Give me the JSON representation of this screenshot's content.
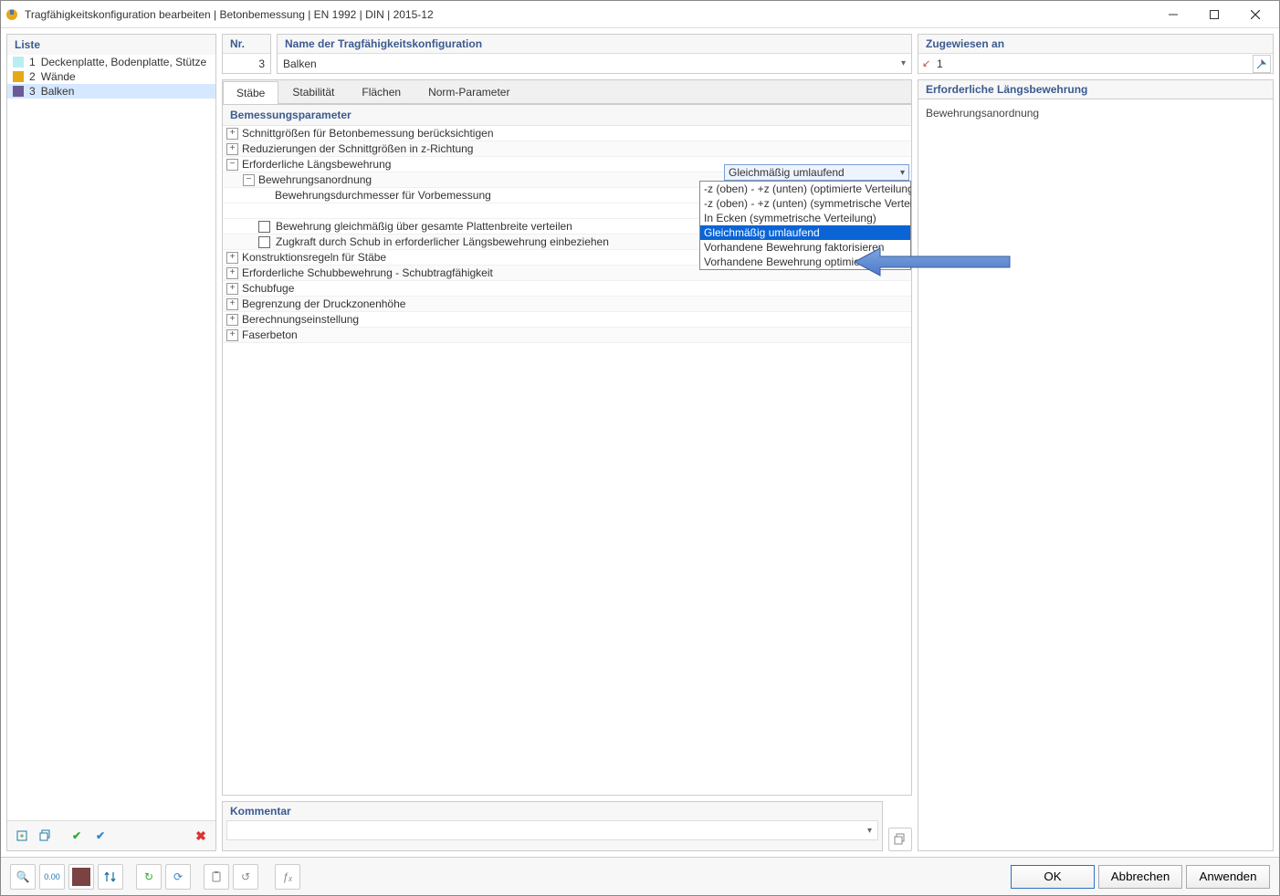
{
  "title": "Tragfähigkeitskonfiguration bearbeiten | Betonbemessung | EN 1992 | DIN | 2015-12",
  "leftPanel": {
    "header": "Liste",
    "items": [
      {
        "num": "1",
        "label": "Deckenplatte, Bodenplatte, Stütze",
        "color": "#b8eef0"
      },
      {
        "num": "2",
        "label": "Wände",
        "color": "#e6a817"
      },
      {
        "num": "3",
        "label": "Balken",
        "color": "#6b5b95"
      }
    ],
    "selectedIndex": 2
  },
  "nrBox": {
    "label": "Nr.",
    "value": "3"
  },
  "nameBox": {
    "label": "Name der Tragfähigkeitskonfiguration",
    "value": "Balken"
  },
  "assigned": {
    "label": "Zugewiesen an",
    "value": "1",
    "iconGlyph": "↙"
  },
  "tabs": {
    "items": [
      "Stäbe",
      "Stabilität",
      "Flächen",
      "Norm-Parameter"
    ],
    "active": 0
  },
  "paramHeader": "Bemessungsparameter",
  "tree": [
    {
      "level": 0,
      "exp": "+",
      "text": "Schnittgrößen für Betonbemessung berücksichtigen"
    },
    {
      "level": 0,
      "exp": "+",
      "text": "Reduzierungen der Schnittgrößen in z-Richtung"
    },
    {
      "level": 0,
      "exp": "-",
      "text": "Erforderliche Längsbewehrung"
    },
    {
      "level": 1,
      "exp": "-",
      "text": "Bewehrungsanordnung",
      "hasCombo": true
    },
    {
      "level": 2,
      "exp": "",
      "text": "Bewehrungsdurchmesser für Vorbemessung"
    },
    {
      "level": 1,
      "exp": "",
      "text": "Bewehrung gleichmäßig über gesamte Plattenbreite verteilen",
      "cb": true
    },
    {
      "level": 1,
      "exp": "",
      "text": "Zugkraft durch Schub in erforderlicher Längsbewehrung einbeziehen",
      "cb": true
    },
    {
      "level": 0,
      "exp": "+",
      "text": "Konstruktionsregeln für Stäbe"
    },
    {
      "level": 0,
      "exp": "+",
      "text": "Erforderliche Schubbewehrung - Schubtragfähigkeit"
    },
    {
      "level": 0,
      "exp": "+",
      "text": "Schubfuge"
    },
    {
      "level": 0,
      "exp": "+",
      "text": "Begrenzung der Druckzonenhöhe"
    },
    {
      "level": 0,
      "exp": "+",
      "text": "Berechnungseinstellung"
    },
    {
      "level": 0,
      "exp": "+",
      "text": "Faserbeton"
    }
  ],
  "comboSelected": "Gleichmäßig umlaufend",
  "dropdown": {
    "items": [
      "-z (oben) - +z (unten) (optimierte Verteilung)",
      "-z (oben) - +z (unten) (symmetrische Verteilung)",
      "In Ecken (symmetrische Verteilung)",
      "Gleichmäßig umlaufend",
      "Vorhandene Bewehrung faktorisieren",
      "Vorhandene Bewehrung optimieren"
    ],
    "highlightIndex": 3
  },
  "detail": {
    "header": "Erforderliche Längsbewehrung",
    "body": "Bewehrungsanordnung"
  },
  "commentLabel": "Kommentar",
  "bottomButtons": {
    "ok": "OK",
    "cancel": "Abbrechen",
    "apply": "Anwenden"
  },
  "icons": {
    "newWindow": "◻",
    "duplicate": "⧉",
    "checkGreen": "✔",
    "checkBlue": "✔",
    "delete": "✖",
    "magnify": "🔍",
    "units": "0.00",
    "colorbox": "#7a4242",
    "tree": "⇵",
    "refreshGreen": "↻",
    "refreshBlue": "⟳",
    "clipboard": "📋",
    "undo": "↺",
    "fx": "ƒₓ",
    "pick": "↖",
    "apply2": "⧉"
  }
}
